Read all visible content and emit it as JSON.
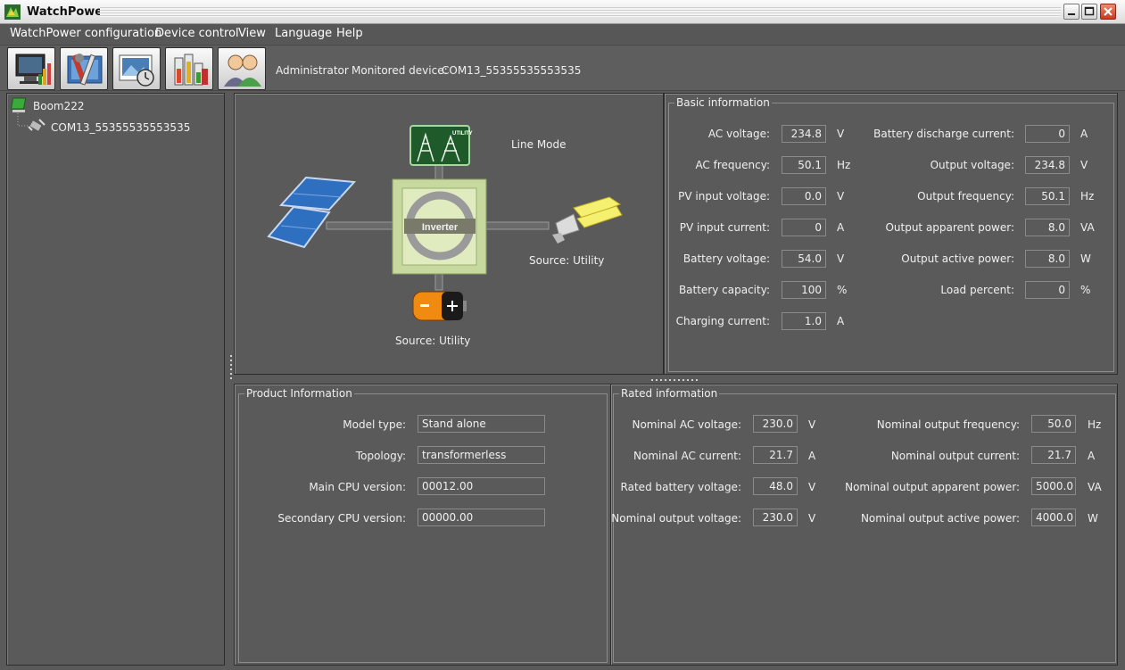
{
  "window": {
    "title": "WatchPower"
  },
  "menu": [
    "WatchPower configuration",
    "Device control",
    "View",
    "Language",
    "Help"
  ],
  "toolbar": {
    "buttons": [
      "monitor-icon",
      "tools-icon",
      "photo-clock-icon",
      "battery-chart-icon",
      "users-icon"
    ],
    "user": "Administrator",
    "monitored_label": "Monitored device:",
    "monitored_value": "COM13_55355535553535"
  },
  "tree": {
    "root": "Boom222",
    "child": "COM13_55355535553535"
  },
  "diagram": {
    "mode": "Line Mode",
    "utility_label": "UTILITY",
    "inverter_label": "Inverter",
    "output_source": "Source:  Utility",
    "battery_source": "Source:  Utility"
  },
  "basic_info": {
    "title": "Basic information",
    "left": [
      {
        "label": "AC voltage:",
        "value": "234.8",
        "unit": "V"
      },
      {
        "label": "AC frequency:",
        "value": "50.1",
        "unit": "Hz"
      },
      {
        "label": "PV input voltage:",
        "value": "0.0",
        "unit": "V"
      },
      {
        "label": "PV input current:",
        "value": "0",
        "unit": "A"
      },
      {
        "label": "Battery voltage:",
        "value": "54.0",
        "unit": "V"
      },
      {
        "label": "Battery capacity:",
        "value": "100",
        "unit": "%"
      },
      {
        "label": "Charging current:",
        "value": "1.0",
        "unit": "A"
      }
    ],
    "right": [
      {
        "label": "Battery discharge current:",
        "value": "0",
        "unit": "A"
      },
      {
        "label": "Output voltage:",
        "value": "234.8",
        "unit": "V"
      },
      {
        "label": "Output frequency:",
        "value": "50.1",
        "unit": "Hz"
      },
      {
        "label": "Output apparent power:",
        "value": "8.0",
        "unit": "VA"
      },
      {
        "label": "Output active power:",
        "value": "8.0",
        "unit": "W"
      },
      {
        "label": "Load percent:",
        "value": "0",
        "unit": "%"
      }
    ]
  },
  "product_info": {
    "title": "Product Information",
    "fields": [
      {
        "label": "Model type:",
        "value": "Stand alone"
      },
      {
        "label": "Topology:",
        "value": "transformerless"
      },
      {
        "label": "Main CPU version:",
        "value": "00012.00"
      },
      {
        "label": "Secondary CPU version:",
        "value": "00000.00"
      }
    ]
  },
  "rated_info": {
    "title": "Rated information",
    "left": [
      {
        "label": "Nominal AC voltage:",
        "value": "230.0",
        "unit": "V"
      },
      {
        "label": "Nominal AC current:",
        "value": "21.7",
        "unit": "A"
      },
      {
        "label": "Rated battery voltage:",
        "value": "48.0",
        "unit": "V"
      },
      {
        "label": "Nominal output voltage:",
        "value": "230.0",
        "unit": "V"
      }
    ],
    "right": [
      {
        "label": "Nominal output frequency:",
        "value": "50.0",
        "unit": "Hz"
      },
      {
        "label": "Nominal output current:",
        "value": "21.7",
        "unit": "A"
      },
      {
        "label": "Nominal output apparent power:",
        "value": "5000.0",
        "unit": "VA"
      },
      {
        "label": "Nominal output active power:",
        "value": "4000.0",
        "unit": "W"
      }
    ]
  }
}
